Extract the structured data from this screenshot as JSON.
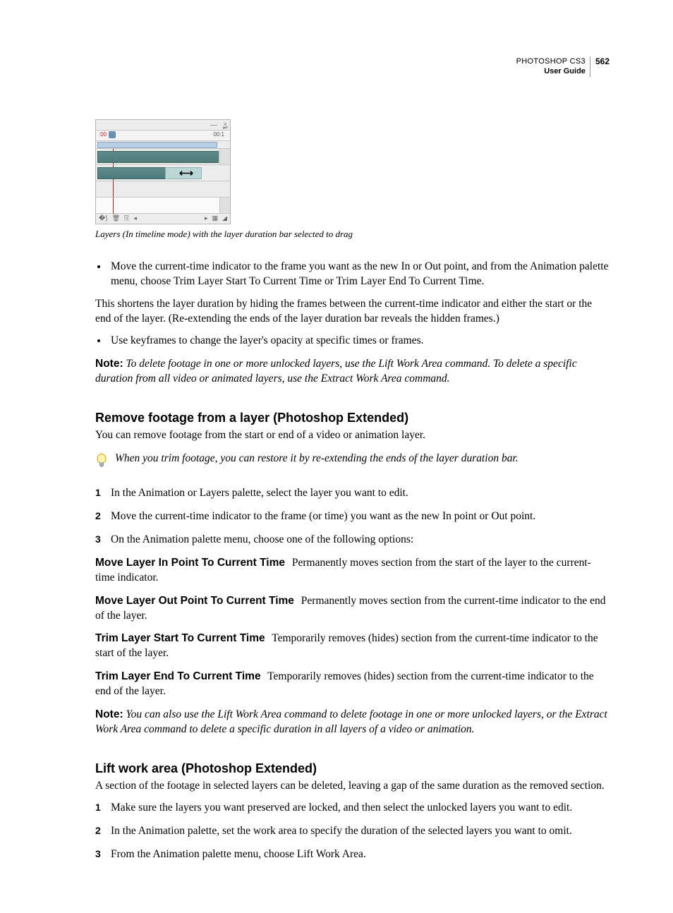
{
  "header": {
    "book": "PHOTOSHOP CS3",
    "guide": "User Guide",
    "page": "562"
  },
  "figure": {
    "time_start": ":00",
    "time_end": "00:1",
    "caption": "Layers (In timeline mode) with the layer duration bar selected to drag"
  },
  "bullets1": [
    "Move the current-time indicator to the frame you want as the new In or Out point, and from the Animation palette menu, choose Trim Layer Start To Current Time or Trim Layer End To Current Time."
  ],
  "para1": "This shortens the layer duration by hiding the frames between the current-time indicator and either the start or the end of the layer. (Re-extending the ends of the layer duration bar reveals the hidden frames.)",
  "bullets2": [
    "Use keyframes to change the layer's opacity at specific times or frames."
  ],
  "note1_label": "Note:",
  "note1": " To delete footage in one or more unlocked layers, use the Lift Work Area command. To delete a specific duration from all video or animated layers, use the Extract Work Area command.",
  "section1": {
    "title": "Remove footage from a layer (Photoshop Extended)",
    "intro": "You can remove footage from the start or end of a video or animation layer.",
    "tip": "When you trim footage, you can restore it by re-extending the ends of the layer duration bar.",
    "steps": [
      "In the Animation or Layers palette, select the layer you want to edit.",
      "Move the current-time indicator to the frame (or time) you want as the new In point or Out point.",
      "On the Animation palette menu, choose one of the following options:"
    ],
    "defs": [
      {
        "term": "Move Layer In Point To Current Time",
        "desc": "Permanently moves section from the start of the layer to the current-time indicator."
      },
      {
        "term": "Move Layer Out Point To Current Time",
        "desc": "Permanently moves section from the current-time indicator to the end of the layer."
      },
      {
        "term": "Trim Layer Start To Current Time",
        "desc": "Temporarily removes (hides) section from the current-time indicator to the start of the layer."
      },
      {
        "term": "Trim Layer End To Current Time",
        "desc": "Temporarily removes (hides) section from the current-time indicator to the end of the layer."
      }
    ],
    "note_label": "Note:",
    "note": " You can also use the Lift Work Area command to delete footage in one or more unlocked layers, or the Extract Work Area command to delete a specific duration in all layers of a video or animation."
  },
  "section2": {
    "title": "Lift work area (Photoshop Extended)",
    "intro": "A section of the footage in selected layers can be deleted, leaving a gap of the same duration as the removed section.",
    "steps": [
      "Make sure the layers you want preserved are locked, and then select the unlocked layers you want to edit.",
      "In the Animation palette, set the work area to specify the duration of the selected layers you want to omit.",
      "From the Animation palette menu, choose Lift Work Area."
    ]
  }
}
